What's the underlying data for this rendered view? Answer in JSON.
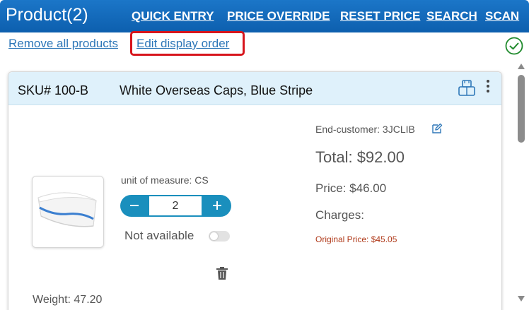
{
  "header": {
    "title": "Product(2)",
    "links": {
      "quick_entry": "QUICK ENTRY",
      "price_override": "PRICE OVERRIDE",
      "reset_price": "RESET PRICE",
      "search": "SEARCH",
      "scan": "SCAN"
    },
    "background_color": "#1166b8"
  },
  "toolbar": {
    "remove_all": "Remove all products",
    "edit_order": "Edit display order",
    "highlight_color": "#d7151c",
    "status_icon": "check-circle-icon"
  },
  "product": {
    "sku": "SKU# 100-B",
    "name": "White Overseas Caps, Blue Stripe",
    "uom": "unit of measure: CS",
    "quantity": "2",
    "availability": "Not available",
    "available_toggle_on": false,
    "end_customer": "End-customer: 3JCLIB",
    "total": "Total: $92.00",
    "price": "Price: $46.00",
    "charges": "Charges:",
    "original_price": "Original Price: $45.05",
    "weight": "Weight: 47.20",
    "icons": [
      "package-icon",
      "more-vert-icon",
      "edit-icon",
      "trash-icon",
      "minus-icon",
      "plus-icon"
    ]
  }
}
